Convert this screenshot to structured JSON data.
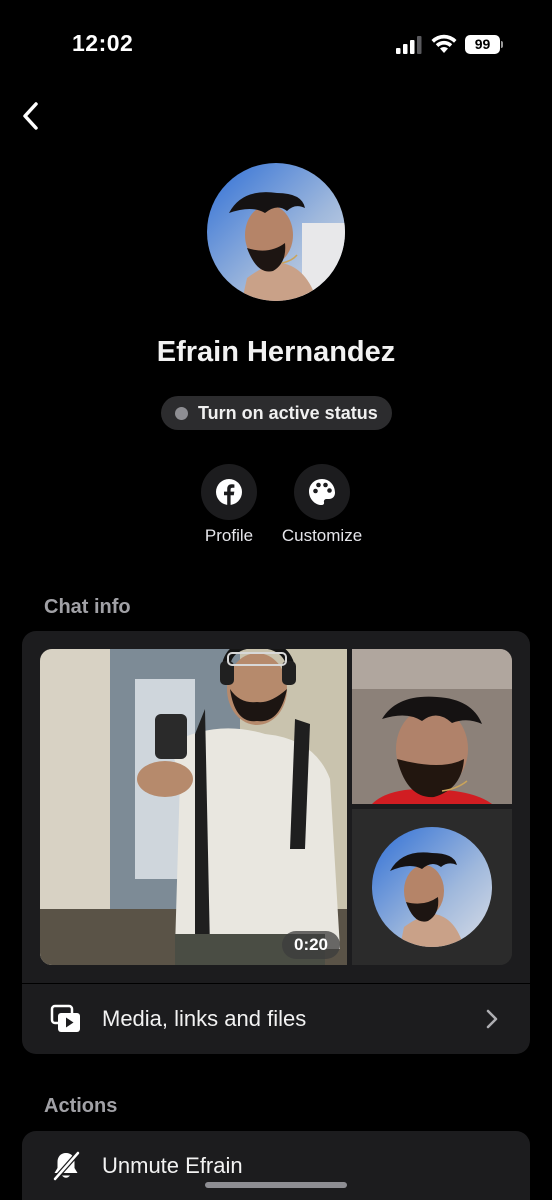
{
  "status_bar": {
    "time": "12:02",
    "battery": "99"
  },
  "profile": {
    "name": "Efrain Hernandez",
    "active_status_label": "Turn on active status"
  },
  "actions_top": [
    {
      "label": "Profile",
      "icon": "facebook-icon"
    },
    {
      "label": "Customize",
      "icon": "palette-icon"
    }
  ],
  "chat_info": {
    "title": "Chat info",
    "video_duration": "0:20",
    "media_row_label": "Media, links and files"
  },
  "actions": {
    "title": "Actions",
    "unmute_label": "Unmute Efrain"
  },
  "colors": {
    "background": "#000000",
    "card": "#1c1c1e",
    "pill": "#2c2c2e",
    "secondary_text": "#a1a1a6"
  }
}
